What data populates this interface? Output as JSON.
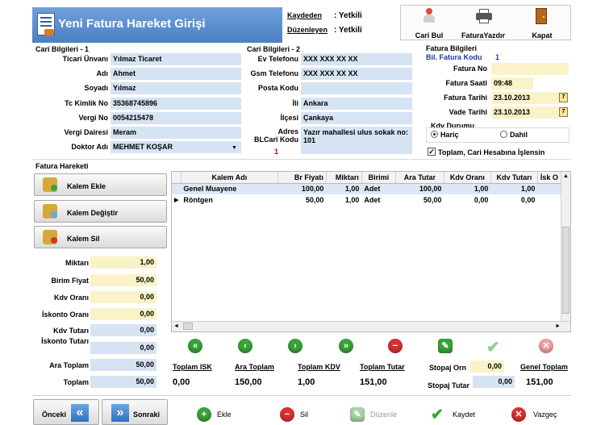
{
  "header": {
    "title": "Yeni Fatura Hareket Girişi",
    "kaydeden_label": "Kaydeden",
    "kaydeden_value": ": Yetkili",
    "duzenleyen_label": "Düzenleyen",
    "duzenleyen_value": ": Yetkili"
  },
  "toolbar": {
    "cari_bul": "Cari Bul",
    "fatura_yazdir": "FaturaYazdır",
    "kapat": "Kapat"
  },
  "cari1": {
    "section": "Cari Bilgileri - 1",
    "rows": [
      {
        "label": "Ticari Ünvanı",
        "value": "Yılmaz Ticaret"
      },
      {
        "label": "Adı",
        "value": "Ahmet"
      },
      {
        "label": "Soyadı",
        "value": "Yılmaz"
      },
      {
        "label": "Tc Kimlik No",
        "value": "35368745896"
      },
      {
        "label": "Vergi No",
        "value": "0054215478"
      },
      {
        "label": "Vergi Dairesi",
        "value": "Meram"
      },
      {
        "label": "Doktor Adı",
        "value": "MEHMET KOŞAR"
      }
    ]
  },
  "cari2": {
    "section": "Cari Bilgileri - 2",
    "ev_label": "Ev Telefonu",
    "ev_value": "XXX XXX XX XX",
    "gsm_label": "Gsm Telefonu",
    "gsm_value": "XXX XXX XX XX",
    "posta_label": "Posta Kodu",
    "posta_value": "",
    "il_label": "İli",
    "il_value": "Ankara",
    "ilce_label": "İlçesi",
    "ilce_value": "Çankaya",
    "adres_label": "Adres",
    "adres_value": "Yazır mahallesi ulus sokak no: 101",
    "blcari_label": "BLCari Kodu",
    "blcari_value": "1"
  },
  "fatura": {
    "section": "Fatura Bilgileri",
    "bil_kodu_label": "Bil. Fatura Kodu",
    "bil_kodu_value": "1",
    "no_label": "Fatura No",
    "no_value": "",
    "saat_label": "Fatura Saati",
    "saat_value": "09:48",
    "tarih_label": "Fatura Tarihi",
    "tarih_value": "23.10.2013",
    "vade_label": "Vade Tarihi",
    "vade_value": "23.10.2013",
    "kdv_durumu_label": "Kdv Durumu",
    "haric": "Hariç",
    "dahil": "Dahil",
    "toplam_check": "Toplam, Cari Hesabına İşlensin"
  },
  "hareket": {
    "section": "Fatura Hareketi",
    "kalem_ekle": "Kalem Ekle",
    "kalem_degistir": "Kalem Değiştir",
    "kalem_sil": "Kalem Sil"
  },
  "inputs": [
    {
      "label": "Miktarı",
      "value": "1,00"
    },
    {
      "label": "Birim Fiyat",
      "value": "50,00"
    },
    {
      "label": "Kdv Oranı",
      "value": "0,00"
    },
    {
      "label": "İskonto Oranı",
      "value": "0,00"
    },
    {
      "label": "Kdv Tutarı",
      "value": "0,00"
    },
    {
      "label": "İskonto Tutarı",
      "value": "0,00"
    },
    {
      "label": "Ara Toplam",
      "value": "50,00"
    },
    {
      "label": "Toplam",
      "value": "50,00"
    }
  ],
  "grid": {
    "columns": [
      "Kalem Adı",
      "Br Fiyatı",
      "Miktarı",
      "Birimi",
      "Ara Tutar",
      "Kdv Oranı",
      "Kdv Tutarı",
      "İsk O"
    ],
    "rows": [
      [
        "Genel Muayene",
        "100,00",
        "1,00",
        "Adet",
        "100,00",
        "1,00",
        "1,00"
      ],
      [
        "Röntgen",
        "50,00",
        "1,00",
        "Adet",
        "50,00",
        "0,00",
        "0,00"
      ]
    ]
  },
  "totals": {
    "toplam_isk_label": "Toplam ISK",
    "toplam_isk": "0,00",
    "ara_toplam_label": "Ara Toplam",
    "ara_toplam": "150,00",
    "toplam_kdv_label": "Toplam KDV",
    "toplam_kdv": "1,00",
    "toplam_tutar_label": "Toplam Tutar",
    "toplam_tutar": "151,00",
    "stopaj_orn_label": "Stopaj Orn",
    "stopaj_orn": "0,00",
    "genel_toplam_label": "Genel Toplam",
    "genel_toplam": "151,00",
    "stopaj_tutar_label": "Stopaj Tutar",
    "stopaj_tutar": "0,00"
  },
  "footer": {
    "onceki": "Önceki",
    "sonraki": "Sonraki",
    "ekle": "Ekle",
    "sil": "Sil",
    "duzenle": "Düzenle",
    "kaydet": "Kaydet",
    "vazgec": "Vazgeç"
  },
  "colors": {
    "title_bar": "#5b8fd0",
    "field": "#d6e3f3",
    "yellow_field": "#faf3c8",
    "nav_green": "#3aa23a",
    "delete_red": "#d93030"
  }
}
